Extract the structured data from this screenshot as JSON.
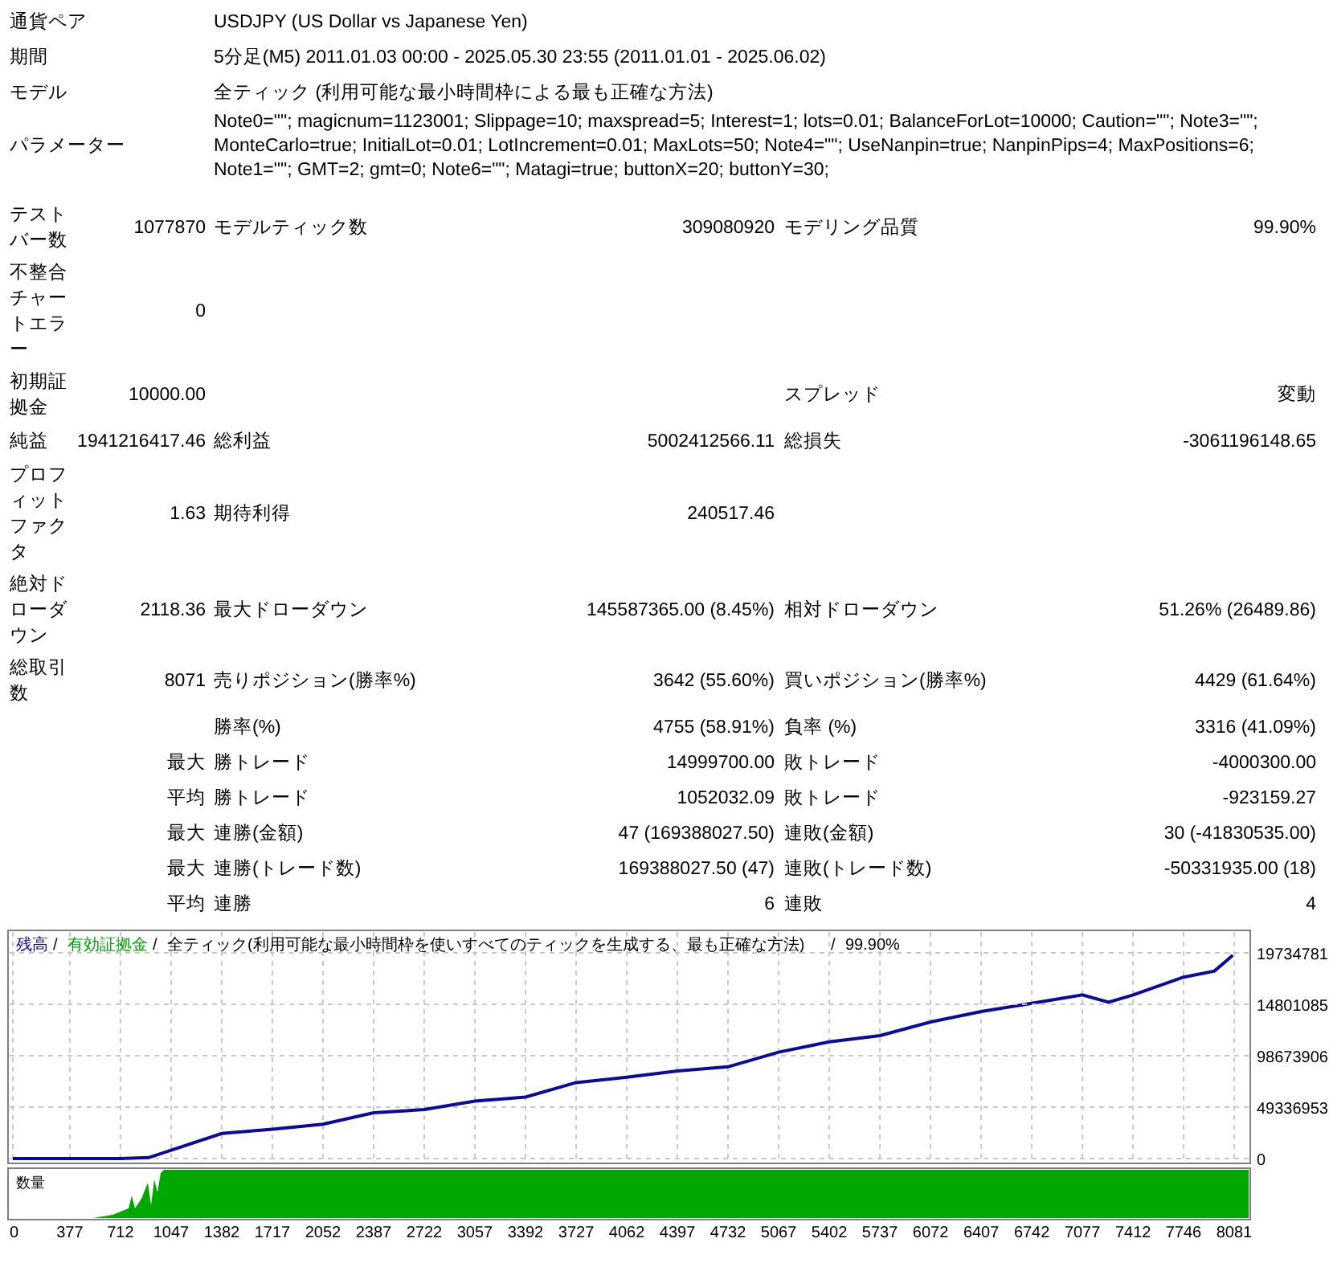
{
  "header_rows": [
    {
      "label": "通貨ペア",
      "value": "USDJPY (US Dollar vs Japanese Yen)"
    },
    {
      "label": "期間",
      "value": "5分足(M5) 2011.01.03 00:00 - 2025.05.30 23:55 (2011.01.01 - 2025.06.02)"
    },
    {
      "label": "モデル",
      "value": "全ティック (利用可能な最小時間枠による最も正確な方法)"
    },
    {
      "label": "パラメーター",
      "value": "Note0=\"\"; magicnum=1123001; Slippage=10; maxspread=5; Interest=1; lots=0.01; BalanceForLot=10000; Caution=\"\"; Note3=\"\"; MonteCarlo=true; InitialLot=0.01; LotIncrement=0.01; MaxLots=50; Note4=\"\"; UseNanpin=true; NanpinPips=4; MaxPositions=6; Note1=\"\"; GMT=2; gmt=0; Note6=\"\"; Matagi=true; buttonX=20; buttonY=30;"
    }
  ],
  "stat_rows": [
    {
      "label_1": "テストバー数",
      "value_1": "1077870",
      "label_2": "モデルティック数",
      "value_2": "309080920",
      "label_3": "モデリング品質",
      "value_3": "99.90%"
    },
    {
      "label_1": "不整合チャートエラー",
      "value_1": "0"
    },
    {
      "label_1": "初期証拠金",
      "value_1": "10000.00",
      "label_3": "スプレッド",
      "value_3": "変動"
    },
    {
      "label_1": "純益",
      "value_1": "1941216417.46",
      "label_2": "総利益",
      "value_2": "5002412566.11",
      "label_3": "総損失",
      "value_3": "-3061196148.65"
    },
    {
      "label_1": "プロフィットファクタ",
      "value_1": "1.63",
      "label_2": "期待利得",
      "value_2": "240517.46"
    },
    {
      "label_1": "絶対ドローダウン",
      "value_1": "2118.36",
      "label_2": "最大ドローダウン",
      "value_2": "145587365.00 (8.45%)",
      "label_3": "相対ドローダウン",
      "value_3": "51.26% (26489.86)"
    },
    {
      "label_1": "総取引数",
      "value_1": "8071",
      "label_2": "売りポジション(勝率%)",
      "value_2": "3642 (55.60%)",
      "label_3": "買いポジション(勝率%)",
      "value_3": "4429 (61.64%)"
    },
    {
      "label_2": "勝率(%)",
      "value_2": "4755 (58.91%)",
      "label_3": "負率 (%)",
      "value_3": "3316 (41.09%)"
    },
    {
      "qualifier": "最大",
      "label_2": "勝トレード",
      "value_2": "14999700.00",
      "label_3": "敗トレード",
      "value_3": "-4000300.00"
    },
    {
      "qualifier": "平均",
      "label_2": "勝トレード",
      "value_2": "1052032.09",
      "label_3": "敗トレード",
      "value_3": "-923159.27"
    },
    {
      "qualifier": "最大",
      "label_2": "連勝(金額)",
      "value_2": "47 (169388027.50)",
      "label_3": "連敗(金額)",
      "value_3": "30 (-41830535.00)"
    },
    {
      "qualifier": "最大",
      "label_2": "連勝(トレード数)",
      "value_2": "169388027.50 (47)",
      "label_3": "連敗(トレード数)",
      "value_3": "-50331935.00 (18)"
    },
    {
      "qualifier": "平均",
      "label_2": "連勝",
      "value_2": "6",
      "label_3": "連敗",
      "value_3": "4"
    }
  ],
  "chart": {
    "legend_separator": "/",
    "legend": [
      {
        "text": "有効証拠金",
        "color": "#00a000"
      },
      {
        "text": "全ティック(利用可能な最小時間枠を使いすべてのティックを生成する、最も正確な方法)",
        "color": "#000000"
      },
      {
        "text": "99.90%",
        "color": "#000000"
      }
    ],
    "volume_label": "数量",
    "clipped_ytick_labels": [
      "19734781",
      "14801085"
    ],
    "chart_data": {
      "type": "line",
      "x": [
        0,
        377,
        712,
        900,
        1047,
        1382,
        1717,
        2052,
        2387,
        2722,
        3057,
        3392,
        3727,
        4062,
        4397,
        4732,
        5067,
        5402,
        5737,
        6072,
        6407,
        6742,
        7077,
        7250,
        7412,
        7746,
        7950,
        8071
      ],
      "series": [
        {
          "name": "残高",
          "color": "#0a0a9e",
          "values": [
            0,
            0,
            0,
            1000000,
            8000000,
            24000000,
            28000000,
            33000000,
            44000000,
            47000000,
            55000000,
            59000000,
            73000000,
            78000000,
            84000000,
            88000000,
            102000000,
            112000000,
            118000000,
            131000000,
            141000000,
            149000000,
            157000000,
            150000000,
            157000000,
            174000000,
            180000000,
            195000000
          ]
        }
      ],
      "xticks": [
        0,
        377,
        712,
        1047,
        1382,
        1717,
        2052,
        2387,
        2722,
        3057,
        3392,
        3727,
        4062,
        4397,
        4732,
        5067,
        5402,
        5737,
        6072,
        6407,
        6742,
        7077,
        7412,
        7746,
        8081
      ],
      "yticks": [
        0,
        49336953,
        98673906
      ],
      "grid": true,
      "xlim": [
        0,
        8081
      ],
      "ylim": [
        0,
        197347812
      ]
    }
  }
}
